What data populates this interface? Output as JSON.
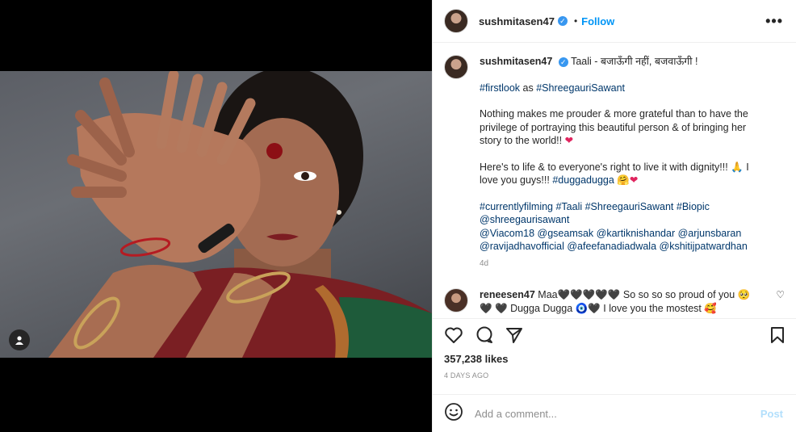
{
  "post": {
    "username": "sushmitasen47",
    "follow_label": "Follow",
    "dot": "•",
    "more": "•••"
  },
  "caption": {
    "username": "sushmitasen47",
    "line1": "Taali - बजाऊँगी नहीं, बजवाऊँगी !",
    "tag1": "#firstlook",
    "as_word": "as",
    "tag2": "#ShreegauriSawant",
    "para2": "Nothing makes me prouder & more grateful than to have the privilege of portraying this beautiful person & of bringing her story to the world!!",
    "para3a": "Here's to life & to everyone's right to live it with dignity!!! 🙏 I love you guys!!!",
    "tag3": "#duggadugga",
    "tags_line": "#currentlyfilming #Taali #ShreegauriSawant #Biopic",
    "mentions1": "@shreegaurisawant",
    "mentions2": "@Viacom18 @gseamsak @kartiknishandar @arjunsbaran",
    "mentions3": "@ravijadhavofficial @afeefanadiadwala @kshitijpatwardhan",
    "time": "4d"
  },
  "comment": {
    "username": "reneesen47",
    "text": "Maa🖤🖤🖤🖤🖤 So so so so proud of you 🥺🖤 🖤 Dugga Dugga 🧿🖤 I love you the mostest 🥰"
  },
  "stats": {
    "likes": "357,238 likes",
    "age": "4 DAYS AGO"
  },
  "comment_input": {
    "placeholder": "Add a comment...",
    "post_label": "Post"
  },
  "icons": {
    "verified": "verified-badge-icon",
    "like": "heart-icon",
    "comment": "comment-icon",
    "share": "share-icon",
    "save": "bookmark-icon",
    "emoji": "emoji-icon",
    "user_tag": "user-icon"
  },
  "colors": {
    "link": "#00376b",
    "follow": "#0095f6",
    "post_disabled": "#b2dffc",
    "verified": "#3897f0"
  }
}
